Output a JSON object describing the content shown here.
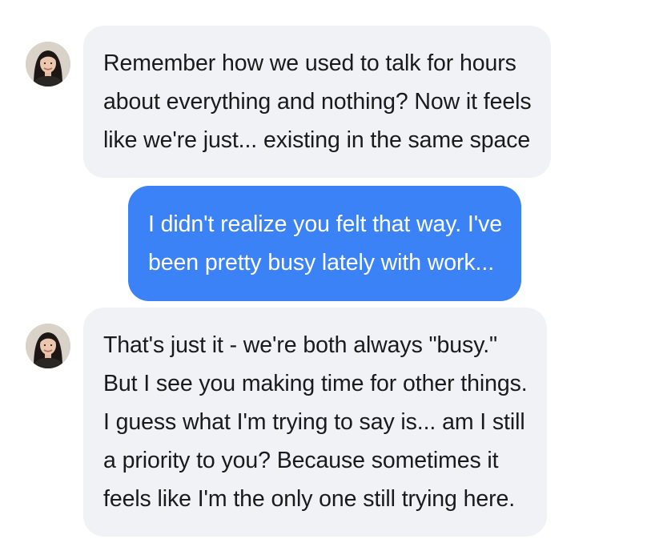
{
  "conversation": {
    "messages": [
      {
        "sender": "contact",
        "lines": [
          "Remember how we used to talk for hours",
          "about everything and nothing? Now it feels",
          "like we're just... existing in the same space"
        ]
      },
      {
        "sender": "me",
        "lines": [
          "I didn't realize you felt that way. I've",
          "been pretty busy lately with work..."
        ]
      },
      {
        "sender": "contact",
        "lines": [
          "That's just it - we're both always \"busy.\"",
          "But I see you making time for other things.",
          "I guess what I'm trying to say is... am I still",
          "a priority to you? Because sometimes it",
          "feels like I'm the only one still trying here."
        ]
      }
    ]
  },
  "colors": {
    "incoming_bubble": "#f1f2f6",
    "outgoing_bubble": "#3b82f6",
    "incoming_text": "#1a1a1a",
    "outgoing_text": "#ffffff"
  },
  "icons": {
    "avatar": "contact-avatar-photo"
  }
}
